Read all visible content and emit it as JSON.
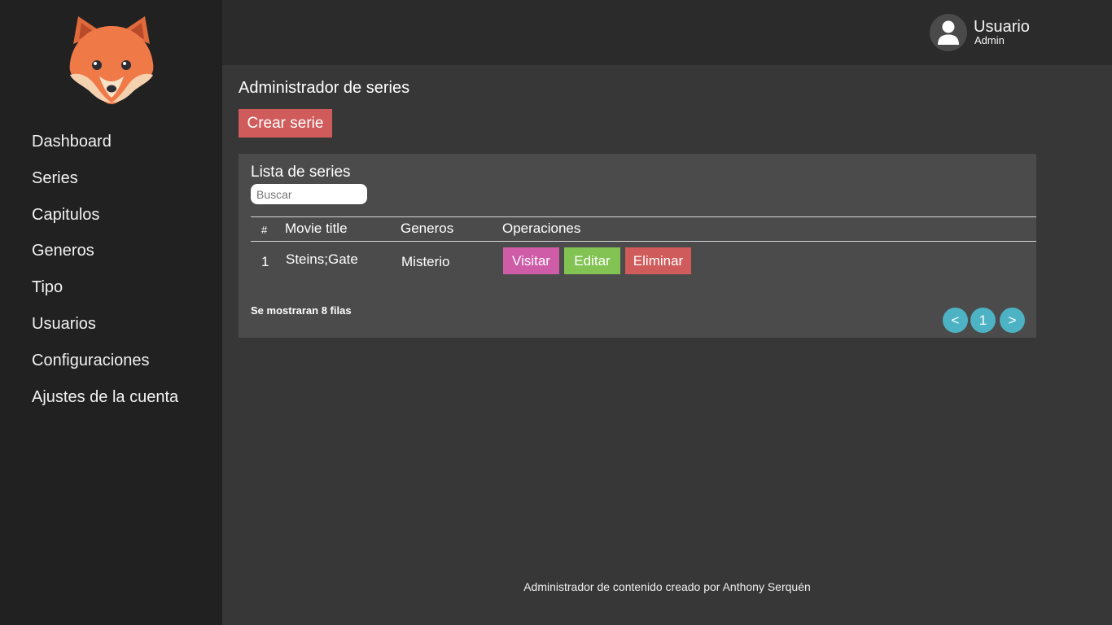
{
  "sidebar": {
    "logo_icon": "fox-logo-icon",
    "items": [
      {
        "label": "Dashboard"
      },
      {
        "label": "Series"
      },
      {
        "label": "Capitulos"
      },
      {
        "label": "Generos"
      },
      {
        "label": "Tipo"
      },
      {
        "label": "Usuarios"
      },
      {
        "label": "Configuraciones"
      },
      {
        "label": "Ajustes de la cuenta"
      }
    ]
  },
  "header": {
    "user_name": "Usuario",
    "user_role": "Admin",
    "avatar_icon": "user-icon"
  },
  "main": {
    "title": "Administrador de series",
    "create_button": "Crear serie",
    "panel": {
      "title": "Lista de series",
      "search_placeholder": "Buscar",
      "columns": [
        "#",
        "Movie title",
        "Generos",
        "Operaciones"
      ],
      "rows": [
        {
          "num": "1",
          "title": "Steins;Gate",
          "genre": "Misterio"
        }
      ],
      "operations": {
        "visit": "Visitar",
        "edit": "Editar",
        "delete": "Eliminar"
      },
      "rows_note": "Se mostraran 8 filas",
      "pagination": {
        "prev": "<",
        "page": "1",
        "next": ">"
      }
    }
  },
  "footer": {
    "text": "Administrador de contenido creado por Anthony Serquén"
  },
  "colors": {
    "sidebar_bg": "#212121",
    "topbar_bg": "#2b2b2b",
    "content_bg": "#373737",
    "panel_bg": "#4b4b4b",
    "danger": "#d05b5b",
    "visit": "#cf5ca7",
    "edit": "#82c354",
    "pager": "#4db3c4"
  }
}
